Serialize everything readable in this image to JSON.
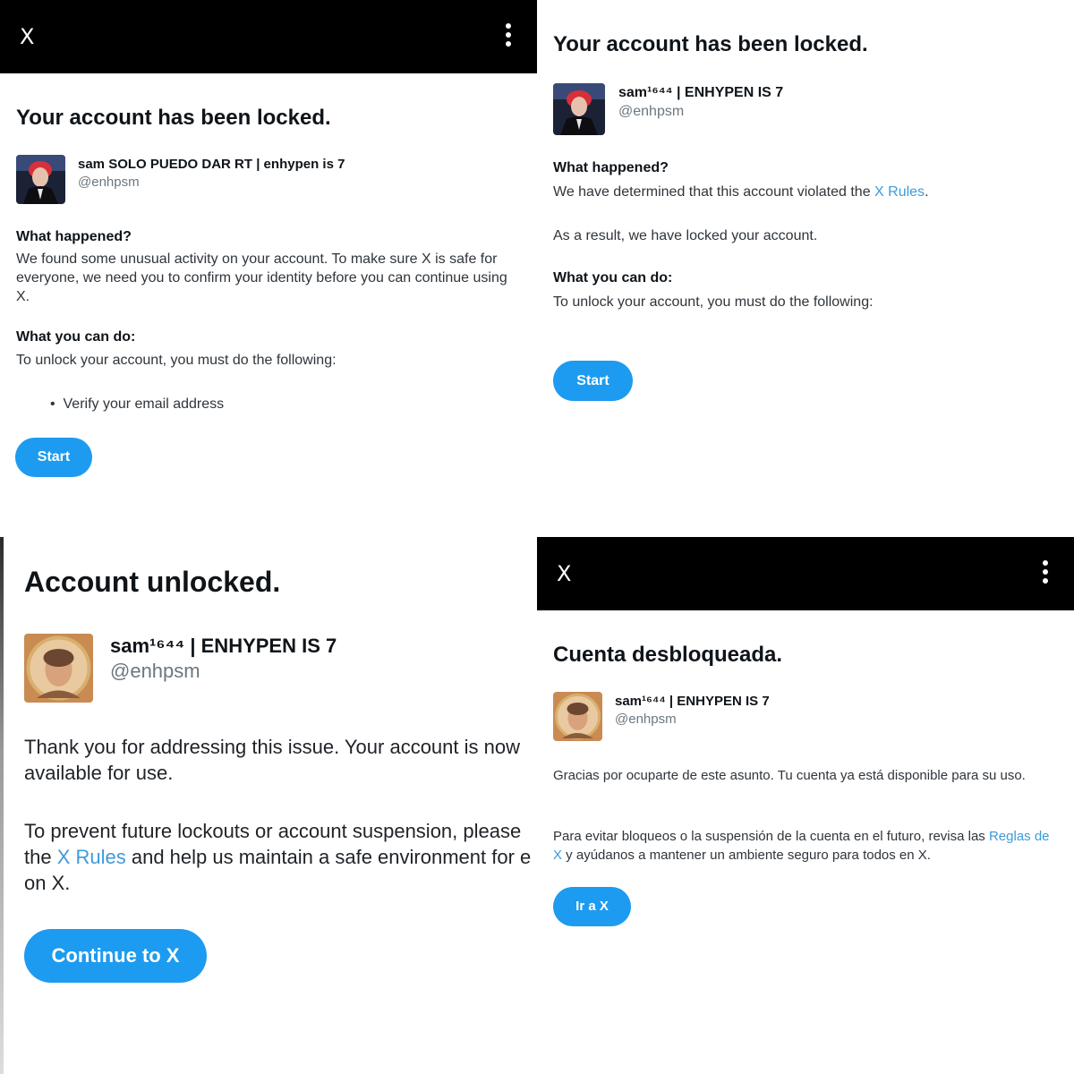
{
  "panels": {
    "locked_en": {
      "topbar": {
        "logo": "X",
        "menu_icon": "more-vertical-icon"
      },
      "title": "Your account has been locked.",
      "account": {
        "name": "sam SOLO PUEDO DAR RT | enhypen is 7",
        "handle": "@enhpsm"
      },
      "what_happened_label": "What happened?",
      "what_happened_text": "We found some unusual activity on your account. To make sure X is safe for everyone, we need you to confirm your identity before you can continue using X.",
      "what_you_can_do_label": "What you can do:",
      "what_you_can_do_text": "To unlock your account, you must do the following:",
      "steps": [
        "Verify your email address"
      ],
      "button_label": "Start"
    },
    "locked_rules": {
      "title": "Your account has been locked.",
      "account": {
        "name": "sam¹⁶⁴⁴ | ENHYPEN IS 7",
        "handle": "@enhpsm"
      },
      "what_happened_label": "What happened?",
      "what_happened_prefix": "We have determined that this account violated the ",
      "what_happened_link": "X Rules",
      "what_happened_suffix": ".",
      "result_text": "As a result, we have locked your account.",
      "what_you_can_do_label": "What you can do:",
      "what_you_can_do_text": "To unlock your account, you must do the following:",
      "button_label": "Start"
    },
    "unlocked_en": {
      "title": "Account unlocked.",
      "account": {
        "name": "sam¹⁶⁴⁴ | ENHYPEN IS 7",
        "handle": "@enhpsm"
      },
      "thanks_text": "Thank you for addressing this issue. Your account is now available for use.",
      "prevent_prefix": "To prevent future lockouts or account suspension, please the ",
      "prevent_link": "X Rules",
      "prevent_suffix": " and help us maintain a safe environment for e on X.",
      "button_label": "Continue to X"
    },
    "unlocked_es": {
      "topbar": {
        "logo": "X",
        "menu_icon": "more-vertical-icon"
      },
      "title": "Cuenta desbloqueada.",
      "account": {
        "name": "sam¹⁶⁴⁴ | ENHYPEN IS 7",
        "handle": "@enhpsm"
      },
      "thanks_text": "Gracias por ocuparte de este asunto. Tu cuenta ya está disponible para su uso.",
      "prevent_prefix": "Para evitar bloqueos o la suspensión de la cuenta en el futuro, revisa las ",
      "prevent_link": "Reglas de X",
      "prevent_suffix": " y ayúdanos a mantener un ambiente seguro para todos en X.",
      "button_label": "Ir a X"
    }
  },
  "colors": {
    "accent": "#1d9bf0",
    "link": "#3e9ad8",
    "topbar": "#000000",
    "text": "#0f1419",
    "muted": "#6b7780"
  }
}
